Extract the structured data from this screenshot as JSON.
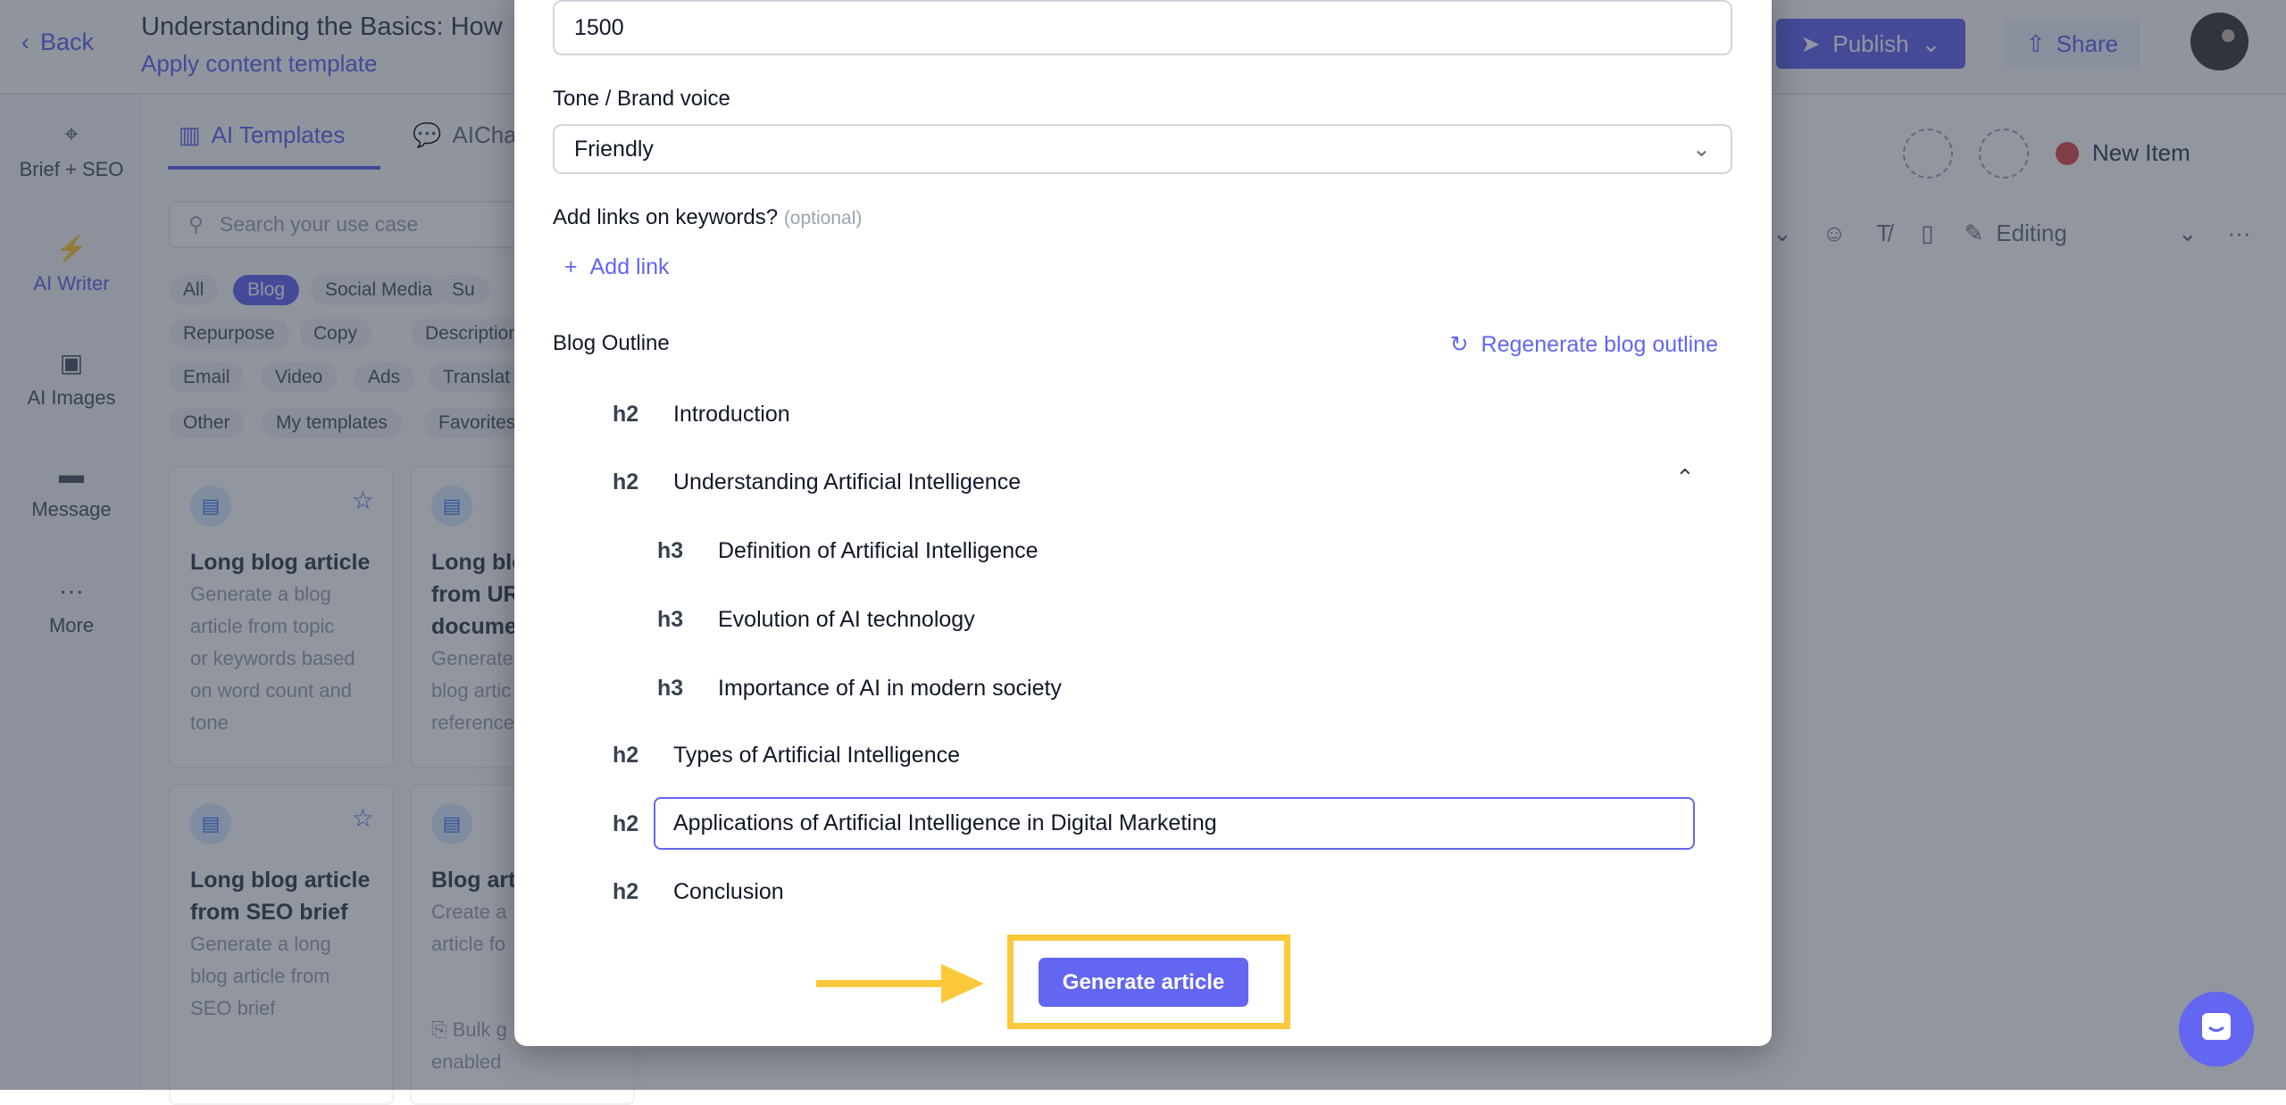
{
  "colors": {
    "accent": "#6366f1",
    "highlight": "#fcc93a",
    "status_dot": "#dc4c4c"
  },
  "header": {
    "back_label": "Back",
    "title": "Understanding the Basics: How",
    "subtitle": "Apply content template",
    "publish_label": "Publish",
    "share_label": "Share"
  },
  "sidebar": {
    "items": [
      {
        "label": "Brief + SEO",
        "icon": "crosshair-icon"
      },
      {
        "label": "AI Writer",
        "icon": "bolt-icon"
      },
      {
        "label": "AI Images",
        "icon": "image-icon"
      },
      {
        "label": "Message",
        "icon": "message-icon"
      },
      {
        "label": "More",
        "icon": "more-icon"
      }
    ]
  },
  "panel": {
    "tabs": [
      {
        "label": "AI Templates"
      },
      {
        "label": "AIChat"
      }
    ],
    "search_placeholder": "Search your use case",
    "chips": [
      "All",
      "Blog",
      "Social Media",
      "Su",
      "Repurpose",
      "Copy",
      "Description",
      "Email",
      "Video",
      "Ads",
      "Translat",
      "Other",
      "My templates",
      "Favorites"
    ],
    "cards": [
      {
        "title": [
          "Long blog article"
        ],
        "desc": [
          "Generate a blog",
          "article from topic",
          "or keywords based",
          "on word count and",
          "tone"
        ]
      },
      {
        "title": [
          "Long blo",
          "from UR",
          "docume"
        ],
        "desc": [
          "Generate",
          "blog artic",
          "reference"
        ]
      },
      {
        "title": [
          "Long blog article",
          "from SEO brief"
        ],
        "desc": [
          "Generate a long",
          "blog article from",
          "SEO brief"
        ]
      },
      {
        "title": [
          "Blog arti"
        ],
        "desc": [
          "Create a",
          "article fo"
        ],
        "footer": "Bulk g",
        "footer2": "enabled"
      }
    ]
  },
  "editor": {
    "status": "New Item",
    "mode": "Editing"
  },
  "modal": {
    "word_count_value": "1500",
    "tone_label": "Tone / Brand voice",
    "tone_value": "Friendly",
    "links_label": "Add links on keywords?",
    "links_optional": "(optional)",
    "add_link_label": "Add link",
    "outline_label": "Blog Outline",
    "regenerate_label": "Regenerate blog outline",
    "outline": [
      {
        "level": "h2",
        "text": "Introduction"
      },
      {
        "level": "h2",
        "text": "Understanding Artificial Intelligence"
      },
      {
        "level": "h3",
        "text": "Definition of Artificial Intelligence"
      },
      {
        "level": "h3",
        "text": "Evolution of AI technology"
      },
      {
        "level": "h3",
        "text": "Importance of AI in modern society"
      },
      {
        "level": "h2",
        "text": "Types of Artificial Intelligence"
      },
      {
        "level": "h2",
        "text": "Applications of Artificial Intelligence in Digital Marketing",
        "editing": true
      },
      {
        "level": "h2",
        "text": "Conclusion"
      }
    ],
    "generate_label": "Generate article"
  }
}
